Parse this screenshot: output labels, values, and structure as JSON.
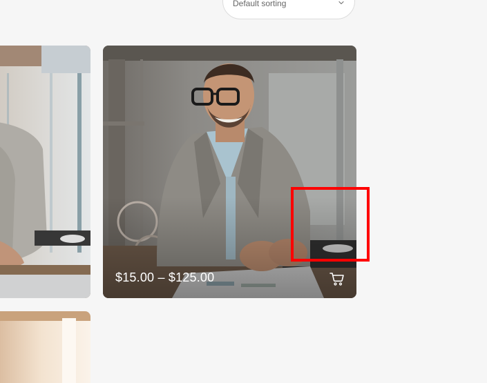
{
  "sort": {
    "selected": "Default sorting",
    "icon": "chevron-down-icon"
  },
  "products": [
    {
      "image": "businessman-smiling-at-desk",
      "price": "$15.00 – $125.00",
      "cart_icon": "cart-icon"
    }
  ],
  "colors": {
    "page_background": "#f6f6f6",
    "price_text": "#ffffff",
    "highlight": "#ff0000"
  }
}
